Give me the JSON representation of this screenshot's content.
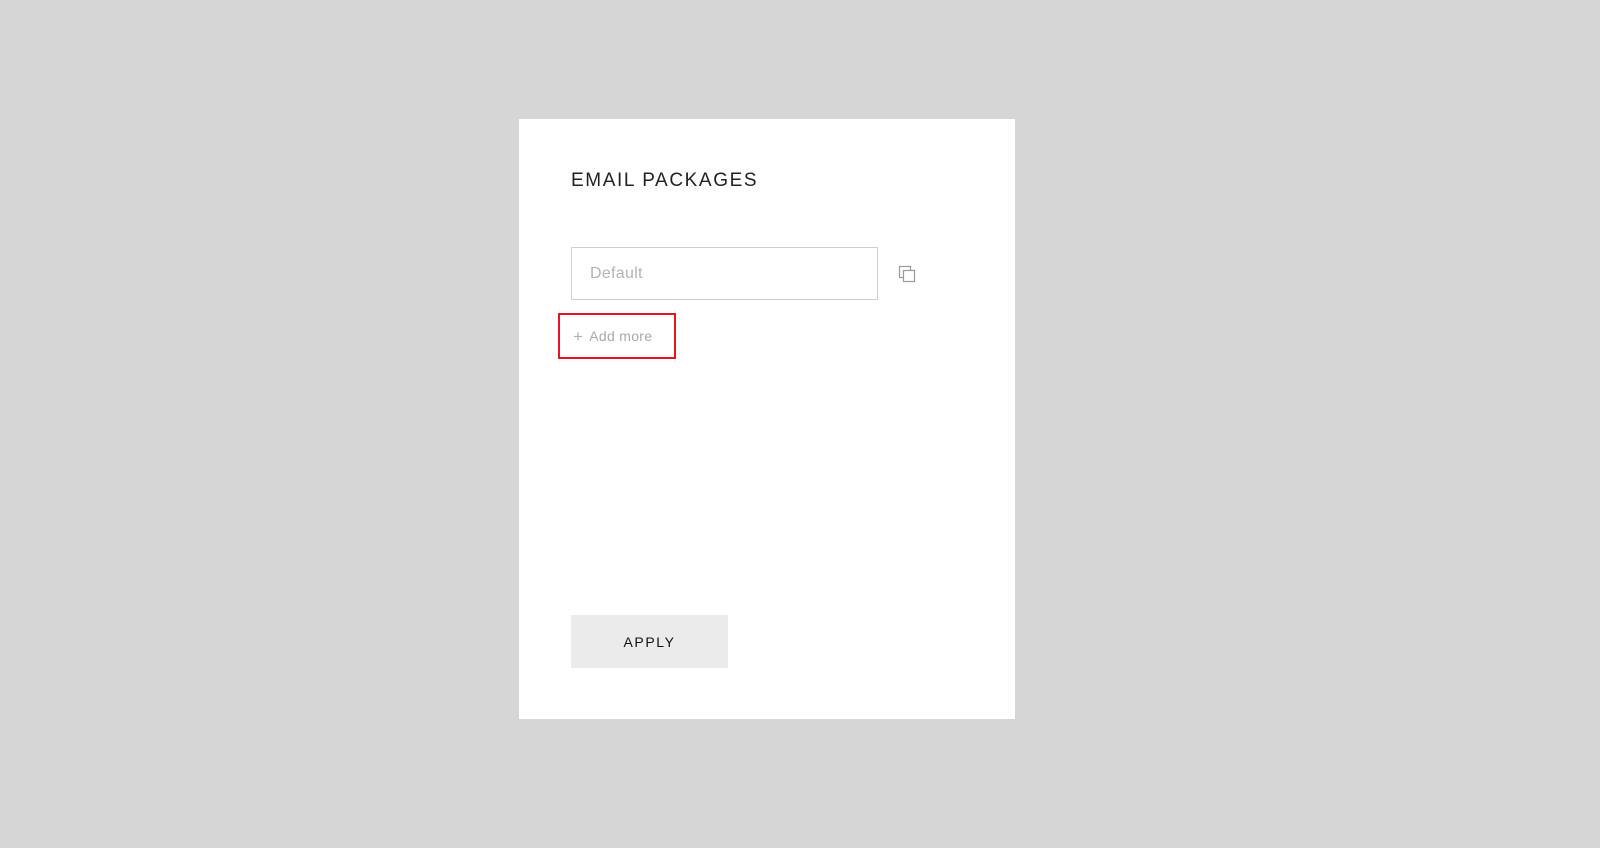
{
  "modal": {
    "title": "EMAIL PACKAGES",
    "packages": [
      {
        "value": "",
        "placeholder": "Default"
      }
    ],
    "copy_icon": "copy-icon",
    "add_more": {
      "icon": "plus-icon",
      "label": "Add more"
    },
    "apply_label": "APPLY"
  },
  "colors": {
    "background": "#d6d6d6",
    "panel": "#ffffff",
    "apply_button_bg": "#ebebeb",
    "highlight_border": "#e8141b",
    "muted_text": "#a9a9a9"
  }
}
